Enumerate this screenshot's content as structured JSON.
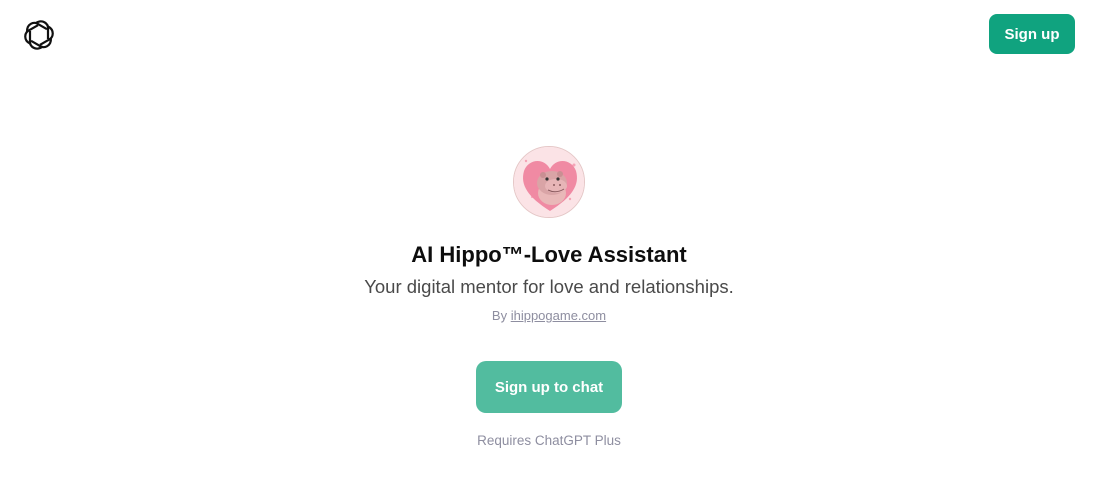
{
  "header": {
    "logo_icon": "openai-logo-icon",
    "signup_label": "Sign up"
  },
  "gpt": {
    "avatar_icon": "hippo-heart-avatar",
    "title": "AI Hippo™-Love Assistant",
    "description": "Your digital mentor for love and relationships.",
    "by_prefix": "By",
    "author": "ihippogame.com"
  },
  "cta": {
    "label": "Sign up to chat",
    "requirement": "Requires ChatGPT Plus"
  },
  "colors": {
    "brand_green": "#10a37f",
    "cta_green": "#52bc9f",
    "muted_text": "#8e8ea0"
  }
}
